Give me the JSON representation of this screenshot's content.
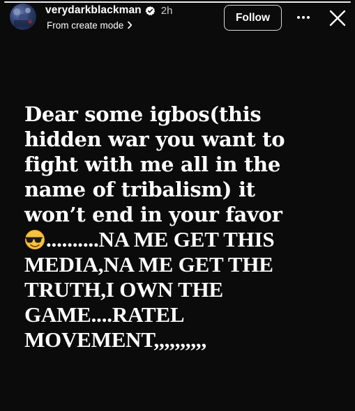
{
  "story": {
    "progress": 1.0
  },
  "header": {
    "username": "verydarkblackman",
    "time": "2h",
    "subline": "From create mode",
    "follow_label": "Follow"
  },
  "caption": {
    "lines": [
      "Dear some igbos(this",
      "hidden war you want to",
      "fight with me all in the",
      "name of tribalism) it",
      "won’t end in your favor",
      "..........NA ME GET THIS",
      "MEDIA,NA ME GET THE",
      "TRUTH,I OWN THE",
      "GAME....RATEL",
      "MOVEMENT,,,,,,,,,,"
    ],
    "emoji": "smiling-face-with-sunglasses"
  },
  "icons": {
    "verified": "verified-badge-icon",
    "chevron": "chevron-right-icon",
    "more": "more-horizontal-icon",
    "close": "close-icon"
  },
  "colors": {
    "background": "#0b0b0b",
    "text": "#ffffff",
    "secondary_text": "#c7c7c7"
  }
}
